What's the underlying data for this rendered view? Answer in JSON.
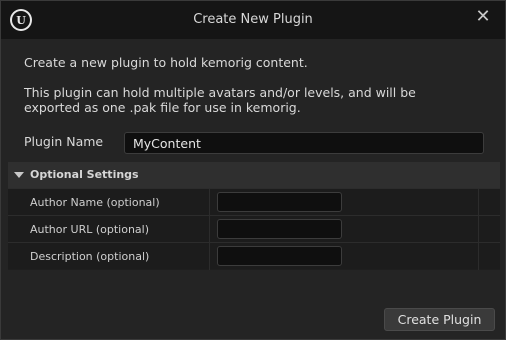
{
  "window": {
    "title": "Create New Plugin",
    "logo_icon": "unreal-engine-logo",
    "logo_glyph": "U",
    "close_icon": "close-icon",
    "close_glyph": "✕"
  },
  "intro": {
    "line1": "Create a new plugin to hold kemorig content.",
    "line2": "This plugin can hold multiple avatars and/or levels, and will be exported as one .pak file for use in kemorig."
  },
  "plugin_name": {
    "label": "Plugin Name",
    "value": "MyContent"
  },
  "optional_settings": {
    "title": "Optional Settings",
    "expanded": true,
    "rows": [
      {
        "label": "Author Name (optional)",
        "value": ""
      },
      {
        "label": "Author URL (optional)",
        "value": ""
      },
      {
        "label": "Description (optional)",
        "value": ""
      }
    ]
  },
  "footer": {
    "create_label": "Create Plugin"
  },
  "colors": {
    "background": "#242424",
    "titlebar": "#151515",
    "input_bg": "#0f0f0f",
    "button_bg": "#3a3a3a"
  }
}
